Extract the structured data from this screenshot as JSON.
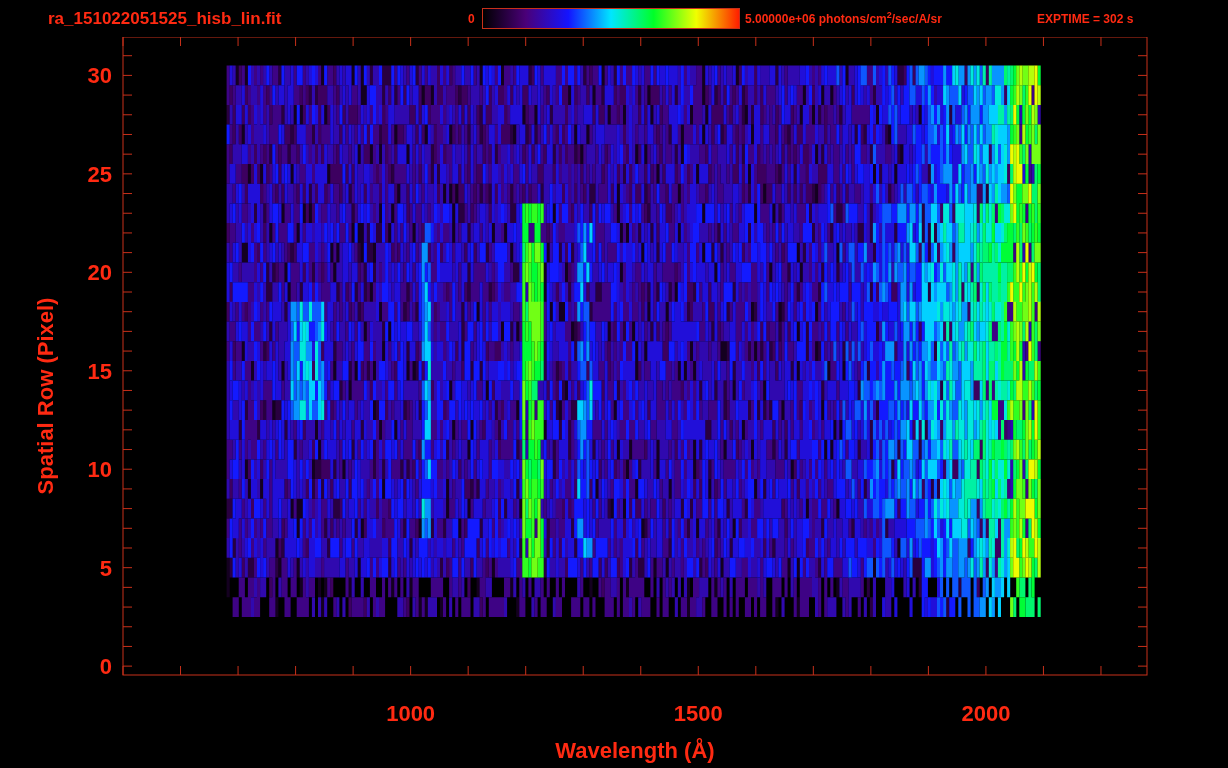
{
  "title": "ra_151022051525_hisb_lin.fit",
  "colorbar": {
    "min_label": "0",
    "max_label": "5.00000e+06 photons/cm$^{2}$/sec/A/sr"
  },
  "exposure": "EXPTIME = 302 s",
  "x_axis": {
    "label": "Wavelength (Å)",
    "ticks": [
      "1000",
      "1500",
      "2000"
    ]
  },
  "y_axis": {
    "label": "Spatial Row (Pixel)",
    "ticks": [
      "30",
      "25",
      "20",
      "15",
      "10",
      "5",
      "0"
    ]
  }
}
